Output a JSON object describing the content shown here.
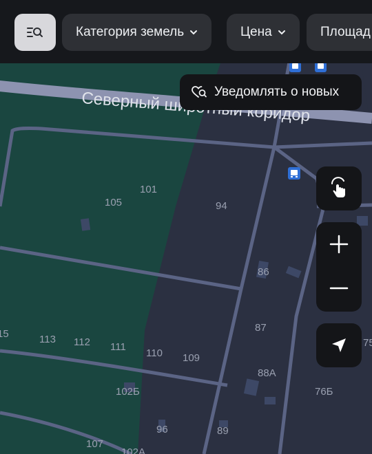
{
  "toolbar": {
    "filters": [
      {
        "label": "Категория земель"
      },
      {
        "label": "Цена"
      },
      {
        "label": "Площад"
      }
    ]
  },
  "notify": {
    "label": "Уведомлять о новых"
  },
  "street": {
    "name": "Северный широтный коридор"
  },
  "plots": [
    "105",
    "101",
    "94",
    "86",
    "87",
    "88А",
    "76Б",
    "75",
    "15",
    "113",
    "112",
    "111",
    "110",
    "109",
    "102Б",
    "96",
    "89",
    "107",
    "102А"
  ],
  "controls": {
    "icons": [
      "hand-pointer-icon",
      "plus-icon",
      "minus-icon",
      "location-arrow-icon"
    ]
  },
  "colors": {
    "greenArea": "#1a4640",
    "urbanArea": "#2b3041",
    "roads": "#5b6485",
    "roadMain": "#8d93b0",
    "busStop": "#2f6fd6"
  }
}
